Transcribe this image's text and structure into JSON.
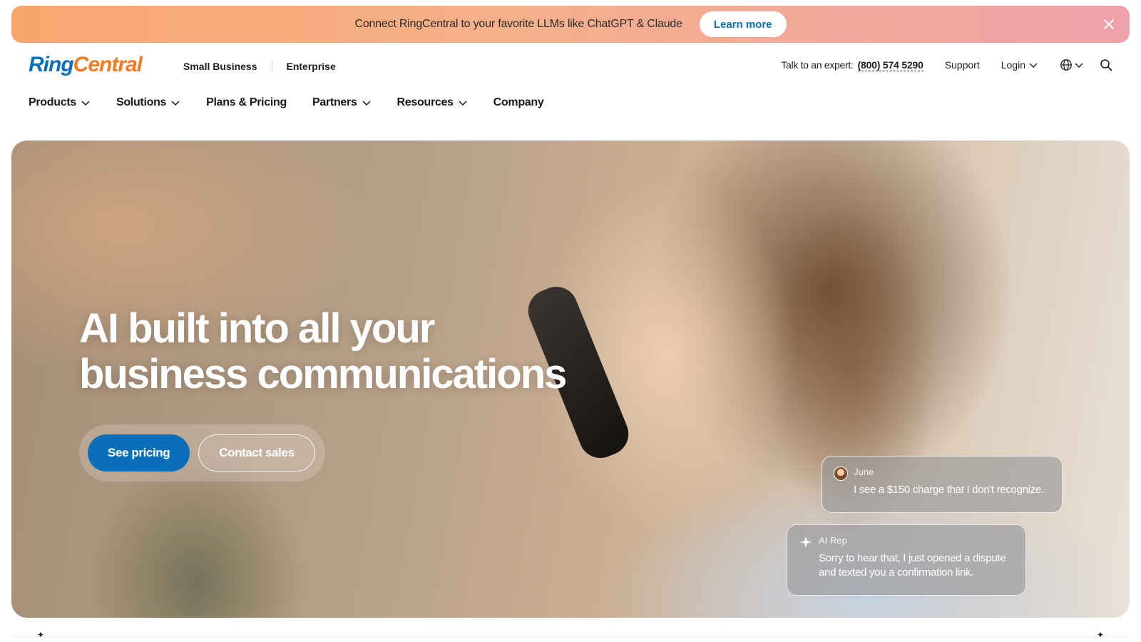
{
  "banner": {
    "text": "Connect RingCentral to your favorite LLMs like ChatGPT & Claude",
    "button_label": "Learn more"
  },
  "header": {
    "logo_ring": "Ring",
    "logo_central": "Central",
    "segments": [
      "Small Business",
      "Enterprise"
    ],
    "expert_label": "Talk to an expert:",
    "phone": "(800) 574 5290",
    "support": "Support",
    "login": "Login"
  },
  "nav": {
    "items": [
      {
        "label": "Products",
        "has_menu": true
      },
      {
        "label": "Solutions",
        "has_menu": true
      },
      {
        "label": "Plans & Pricing",
        "has_menu": false
      },
      {
        "label": "Partners",
        "has_menu": true
      },
      {
        "label": "Resources",
        "has_menu": true
      },
      {
        "label": "Company",
        "has_menu": false
      }
    ]
  },
  "hero": {
    "title_line1": "AI built into all your",
    "title_line2": "business communications",
    "primary_cta": "See pricing",
    "secondary_cta": "Contact sales",
    "chat": [
      {
        "speaker": "June",
        "message": "I see a $150 charge that I don't recognize."
      },
      {
        "speaker": "AI Rep",
        "message": "Sorry to hear that, I just opened a dispute and texted you a confirmation link."
      }
    ]
  },
  "colors": {
    "brand_blue": "#0a6fb8",
    "brand_orange": "#f47a20",
    "banner_start": "#f8a66f",
    "banner_end": "#eea1a8"
  },
  "icons": {
    "banner_close": "close-icon",
    "language": "globe-icon",
    "search": "search-icon",
    "dropdown": "chevron-down-icon",
    "ai_rep": "sparkle-icon"
  }
}
